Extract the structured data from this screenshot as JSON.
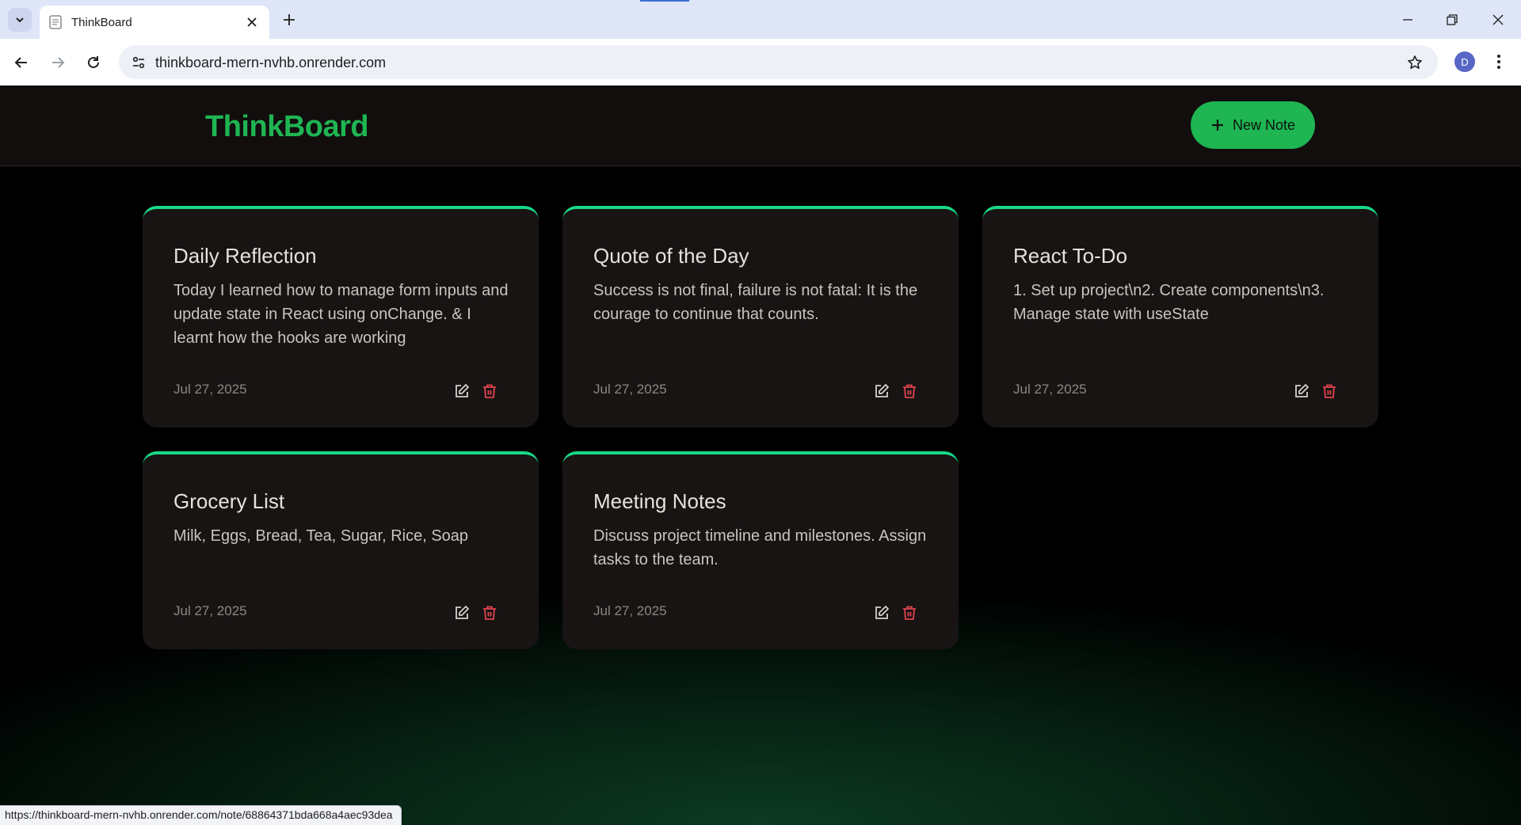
{
  "browser": {
    "tab_title": "ThinkBoard",
    "url": "thinkboard-mern-nvhb.onrender.com",
    "avatar_letter": "D",
    "status_url": "https://thinkboard-mern-nvhb.onrender.com/note/68864371bda668a4aec93dea"
  },
  "app": {
    "brand": "ThinkBoard",
    "new_note_label": "New Note",
    "colors": {
      "brand": "#1fb553",
      "card_accent": "#18d987",
      "delete": "#e0434e"
    }
  },
  "notes": [
    {
      "title": "Daily Reflection",
      "content": "Today I learned how to manage form inputs and update state in React using onChange. & I learnt how the hooks are working",
      "date": "Jul 27, 2025"
    },
    {
      "title": "Quote of the Day",
      "content": "Success is not final, failure is not fatal: It is the courage to continue that counts.",
      "date": "Jul 27, 2025"
    },
    {
      "title": "React To-Do",
      "content": "1. Set up project\\n2. Create components\\n3. Manage state with useState",
      "date": "Jul 27, 2025"
    },
    {
      "title": "Grocery List",
      "content": "Milk, Eggs, Bread, Tea, Sugar, Rice, Soap",
      "date": "Jul 27, 2025"
    },
    {
      "title": "Meeting Notes",
      "content": "Discuss project timeline and milestones. Assign tasks to the team.",
      "date": "Jul 27, 2025"
    }
  ]
}
